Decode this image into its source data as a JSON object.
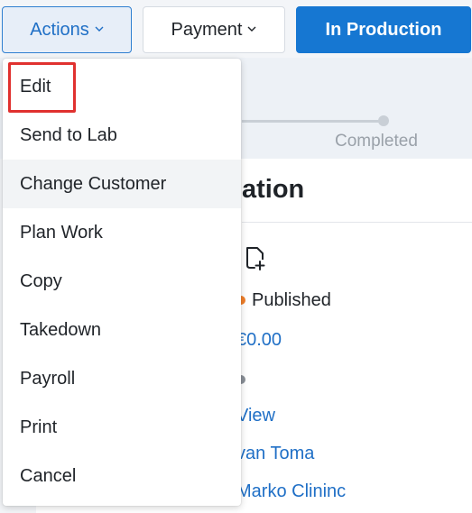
{
  "toolbar": {
    "actions_label": "Actions",
    "payment_label": "Payment",
    "production_label": "In Production"
  },
  "progress": {
    "completed_label": "Completed"
  },
  "details": {
    "section_title_fragment": "ation",
    "status": "Published",
    "amount": "€0.00",
    "view_link": "View",
    "person": "van Toma",
    "clinic": "Marko Clininc"
  },
  "menu": {
    "items": [
      {
        "label": "Edit"
      },
      {
        "label": "Send to Lab"
      },
      {
        "label": "Change Customer"
      },
      {
        "label": "Plan Work"
      },
      {
        "label": "Copy"
      },
      {
        "label": "Takedown"
      },
      {
        "label": "Payroll"
      },
      {
        "label": "Print"
      },
      {
        "label": "Cancel"
      }
    ]
  },
  "colors": {
    "primary": "#1677d2",
    "link": "#1f6fc6",
    "highlight": "#e0312f",
    "status_published": "#f07f2a"
  }
}
